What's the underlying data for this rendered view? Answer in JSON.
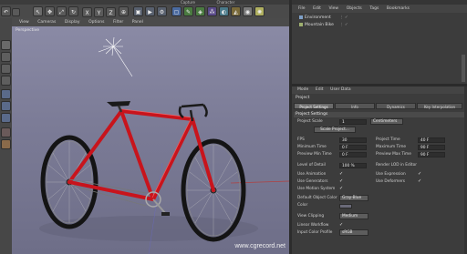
{
  "top_menu": [
    "Capture",
    "Character"
  ],
  "viewport": {
    "menu": [
      "View",
      "Cameras",
      "Display",
      "Options",
      "Filter",
      "Panel"
    ],
    "camera_label": "Perspective"
  },
  "watermark": "www.cgrecord.net",
  "objects": {
    "menu": [
      "File",
      "Edit",
      "View",
      "Objects",
      "Tags",
      "Bookmarks"
    ],
    "items": [
      {
        "name": "Environment"
      },
      {
        "name": "Mountain Bike"
      }
    ]
  },
  "attributes": {
    "menu": [
      "Mode",
      "Edit",
      "User Data"
    ],
    "title": "Project",
    "tabs": [
      "Project Settings",
      "Info",
      "Dynamics",
      "Key Interpolation"
    ],
    "section": "Project Settings",
    "project_scale_label": "Project Scale",
    "project_scale_value": "1",
    "project_scale_unit": "Centimeters",
    "scale_project_button": "Scale Project...",
    "fps_label": "FPS",
    "fps_value": "30",
    "project_time_label": "Project Time",
    "project_time_value": "40 F",
    "minimum_time_label": "Minimum Time",
    "minimum_time_value": "0 F",
    "maximum_time_label": "Maximum Time",
    "maximum_time_value": "90 F",
    "preview_min_label": "Preview Min Time",
    "preview_min_value": "0 F",
    "preview_max_label": "Preview Max Time",
    "preview_max_value": "90 F",
    "lod_label": "Level of Detail",
    "lod_value": "100 %",
    "render_lod_label": "Render LOD in Editor",
    "use_animation_label": "Use Animation",
    "use_expression_label": "Use Expression",
    "use_generators_label": "Use Generators",
    "use_deformers_label": "Use Deformers",
    "use_motion_label": "Use Motion System",
    "default_color_label": "Default Object Color",
    "default_color_value": "Gray-Blue",
    "color_label": "Color",
    "view_clipping_label": "View Clipping",
    "view_clipping_value": "Medium",
    "linear_workflow_label": "Linear Workflow",
    "input_profile_label": "Input Color Profile",
    "input_profile_value": "sRGB"
  },
  "colors": {
    "bike_frame": "#c8141c",
    "viewport_bg": "#7e7e98",
    "panel_bg": "#3c3c3c"
  }
}
